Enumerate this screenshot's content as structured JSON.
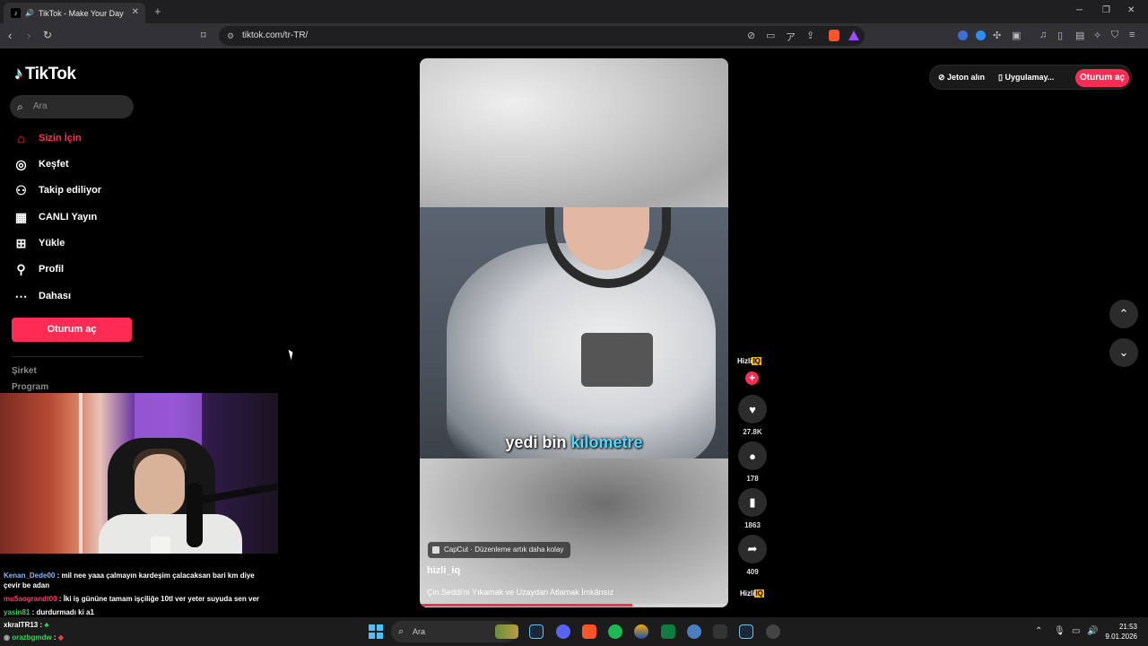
{
  "browser": {
    "tab_title": "TikTok - Make Your Day",
    "url": "tiktok.com/tr-TR/",
    "new_tab": "+",
    "window_controls": [
      "─",
      "❐",
      "✕"
    ]
  },
  "sidebar": {
    "logo_text": "TikTok",
    "search_placeholder": "Ara",
    "items": [
      {
        "label": "Sizin İçin",
        "icon": "home-icon",
        "active": true
      },
      {
        "label": "Keşfet",
        "icon": "compass-icon"
      },
      {
        "label": "Takip ediliyor",
        "icon": "following-icon"
      },
      {
        "label": "CANLI Yayın",
        "icon": "live-icon"
      },
      {
        "label": "Yükle",
        "icon": "upload-icon"
      },
      {
        "label": "Profil",
        "icon": "profile-icon"
      },
      {
        "label": "Dahası",
        "icon": "more-icon"
      }
    ],
    "login_button": "Oturum aç",
    "footer_links": [
      "Şirket",
      "Program"
    ]
  },
  "video": {
    "caption_part1": "yedi bin",
    "caption_part2": "kilometre",
    "capcut_tag": "CapCut · Düzenleme artık daha kolay",
    "author": "hizli_iq",
    "description": "Çin Seddi'ni Yıkamak ve Uzaydan Atlamak İmkânsız",
    "progress": 0.69
  },
  "rail": {
    "avatar_text": "Hizli",
    "avatar_badge": "IQ",
    "likes": "27.8K",
    "comments": "178",
    "saves": "1863",
    "shares": "409"
  },
  "header": {
    "coins": "Jeton alın",
    "app": "Uygulamay...",
    "login": "Oturum aç"
  },
  "chat": [
    {
      "user": "Kenan_Dede00",
      "text": " : mil nee yaaa çalmayın kardeşim çalacaksan bari km diye çevir be adan",
      "color": "u1"
    },
    {
      "user": "mu5aograndt00",
      "text": " : İki iş gününe tamam işçiliğe 10tl ver yeter suyuda sen ver",
      "color": "u2"
    },
    {
      "user": "yasin81",
      "text": " : durdurmadı ki a1",
      "color": "u3"
    },
    {
      "user": "xkralTR13",
      "text": " :",
      "color": ""
    },
    {
      "user": "orazbgmdw",
      "text": " :",
      "color": "u3"
    }
  ],
  "taskbar": {
    "search_placeholder": "Ara",
    "time": "21:53",
    "date": "9.01.2026"
  },
  "colors": {
    "accent": "#fe2c55",
    "background": "#000000",
    "caption_highlight": "#52d8ff"
  }
}
